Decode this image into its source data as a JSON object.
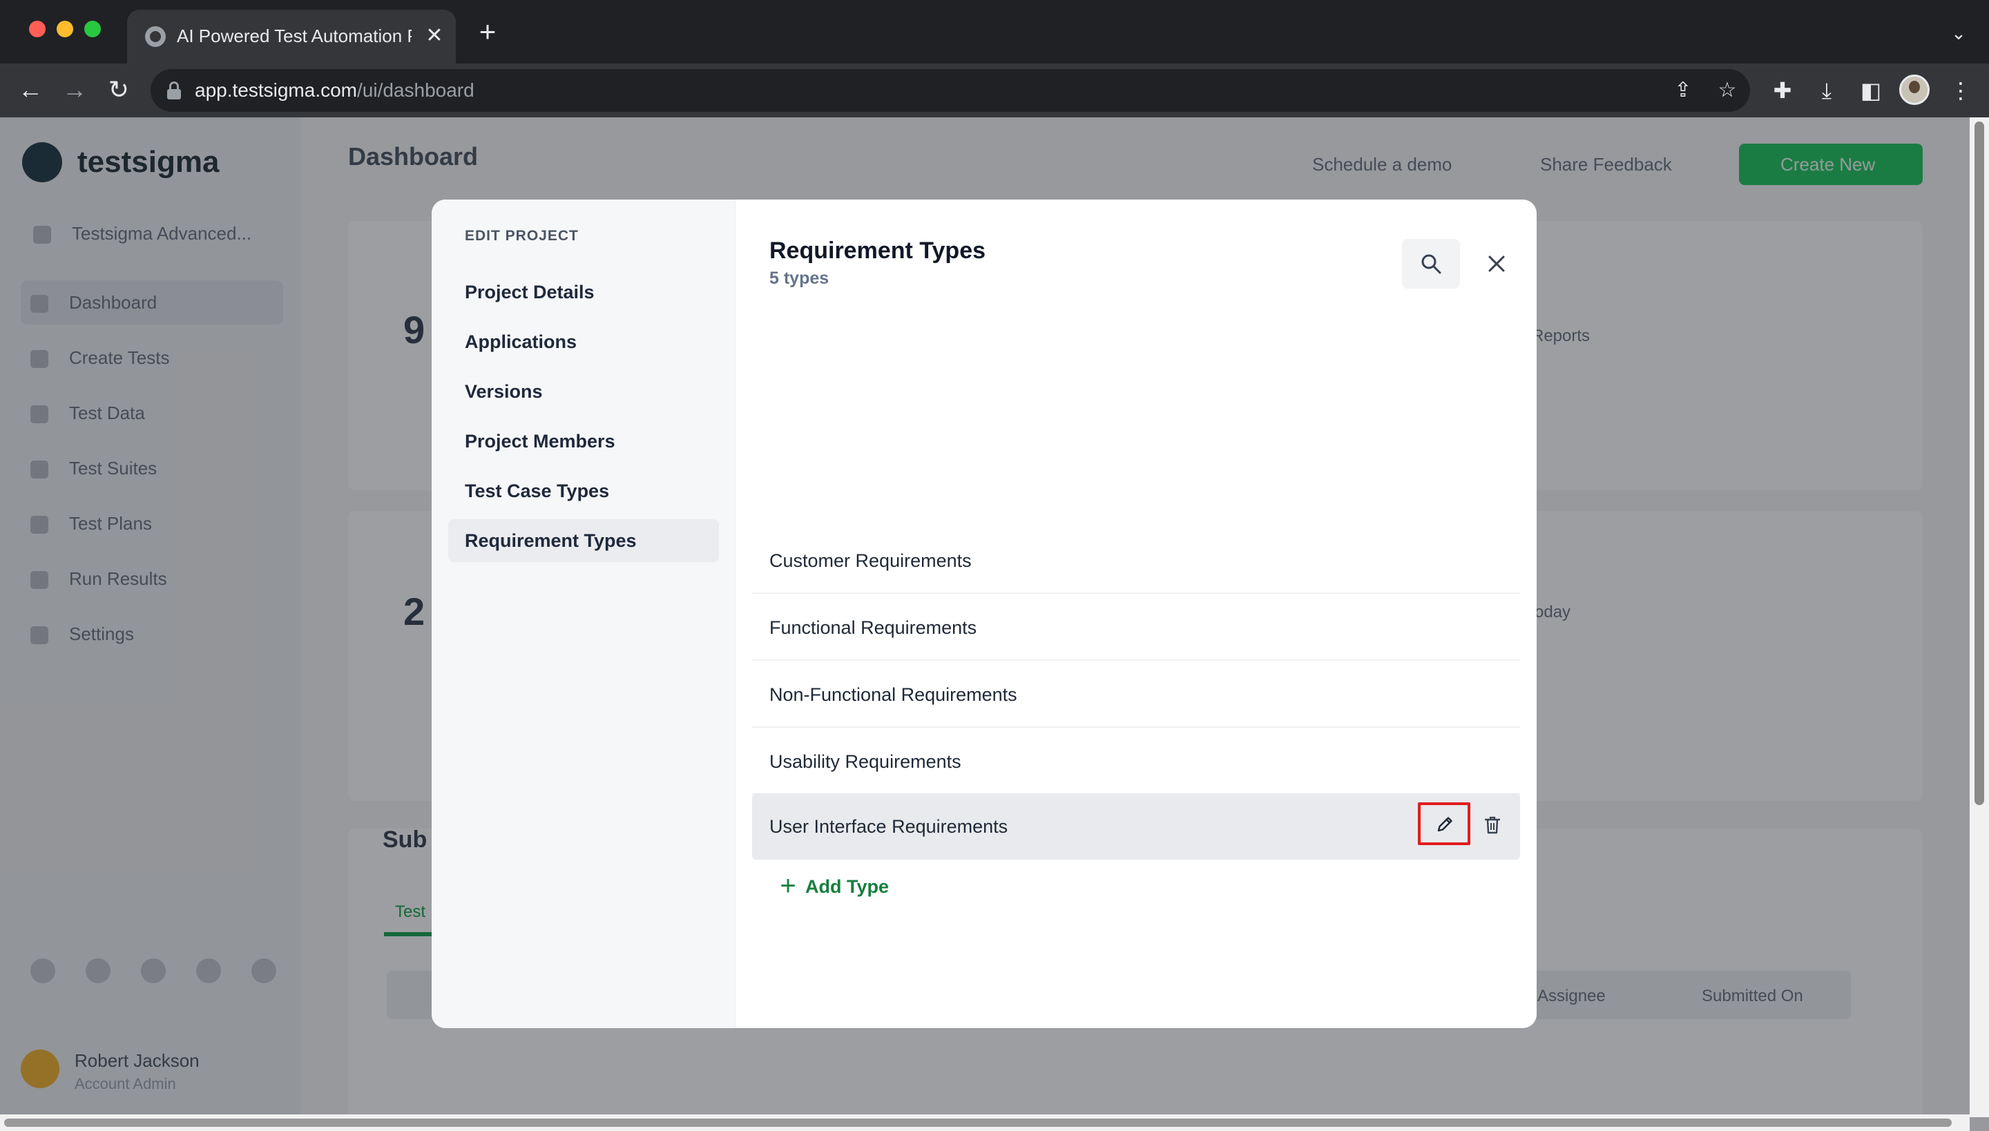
{
  "browser": {
    "tab_title": "AI Powered Test Automation P",
    "tab_close": "✕",
    "new_tab": "+",
    "url_host": "app.testsigma.com",
    "url_path": "/ui/dashboard",
    "icons": [
      "globe-icon",
      "back-icon",
      "forward-icon",
      "reload-icon",
      "lock-icon",
      "share-icon",
      "star-icon",
      "extensions-icon",
      "download-icon",
      "sidepanel-icon",
      "profile-avatar",
      "kebab-menu-icon"
    ]
  },
  "app_background": {
    "logo_text": "testsigma",
    "project_name": "Testsigma Advanced...",
    "sidebar_items": [
      "Dashboard",
      "Create Tests",
      "Test Data",
      "Test Suites",
      "Test Plans",
      "Run Results",
      "Settings"
    ],
    "page_title": "Dashboard",
    "schedule_demo": "Schedule a demo",
    "share_feedback": "Share Feedback",
    "create_new": "Create New",
    "user_name": "Robert Jackson",
    "user_role": "Account Admin"
  },
  "modal": {
    "nav_heading": "EDIT PROJECT",
    "nav_items": [
      {
        "label": "Project Details"
      },
      {
        "label": "Applications"
      },
      {
        "label": "Versions"
      },
      {
        "label": "Project Members"
      },
      {
        "label": "Test Case Types"
      },
      {
        "label": "Requirement Types"
      }
    ],
    "active_nav": "Requirement Types",
    "title": "Requirement Types",
    "count": "5 types",
    "types": [
      {
        "label": "Customer Requirements"
      },
      {
        "label": "Functional Requirements"
      },
      {
        "label": "Non-Functional Requirements"
      },
      {
        "label": "Usability Requirements"
      },
      {
        "label": "User Interface Requirements"
      }
    ],
    "hovered_type": "User Interface Requirements",
    "add_type_label": "Add Type",
    "add_type_icon": "+",
    "accent_color": "#15803d",
    "highlight_color": "#e11d1d"
  }
}
